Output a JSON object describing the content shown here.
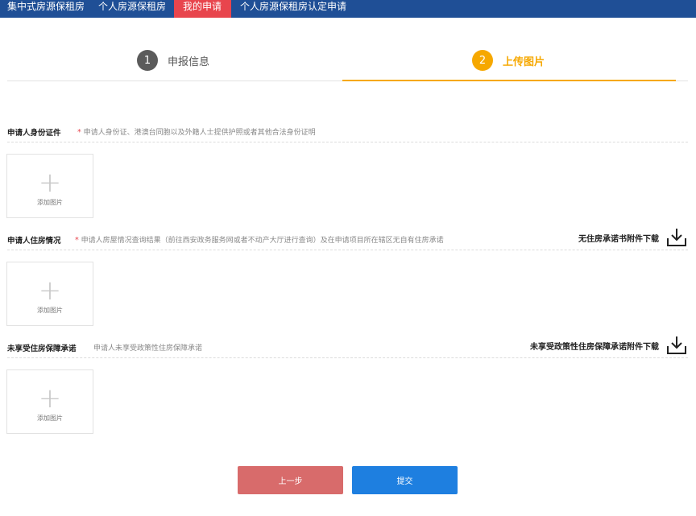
{
  "nav": {
    "items": [
      {
        "label": "集中式房源保租房"
      },
      {
        "label": "个人房源保租房"
      },
      {
        "label": "我的申请"
      },
      {
        "label": "个人房源保租房认定申请"
      }
    ],
    "active": "我的申请"
  },
  "steps": [
    {
      "number": "1",
      "label": "申报信息"
    },
    {
      "number": "2",
      "label": "上传图片"
    }
  ],
  "sections": [
    {
      "title": "申请人身份证件",
      "required_mark": "*",
      "description": "申请人身份证、港澳台同胞以及外籍人士提供护照或者其他合法身份证明",
      "upload_label": "添加图片"
    },
    {
      "title": "申请人住房情况",
      "required_mark": "*",
      "description": "申请人房屋情况查询结果（前往西安政务服务网或者不动产大厅进行查询）及在申请项目所在辖区无自有住房承诺",
      "download_label": "无住房承诺书附件下载",
      "upload_label": "添加图片"
    },
    {
      "title": "未享受住房保障承诺",
      "description": "申请人未享受政策性住房保障承诺",
      "download_label": "未享受政策性住房保障承诺附件下载",
      "upload_label": "添加图片"
    }
  ],
  "buttons": {
    "prev": "上一步",
    "submit": "提交"
  },
  "colors": {
    "nav_bg": "#1f4f96",
    "nav_active": "#e8454d",
    "step_active": "#f6a800",
    "prev_button": "#d86b6b",
    "submit_button": "#1e7fe0"
  },
  "icons": {
    "download": "download-icon",
    "add": "plus-icon"
  }
}
